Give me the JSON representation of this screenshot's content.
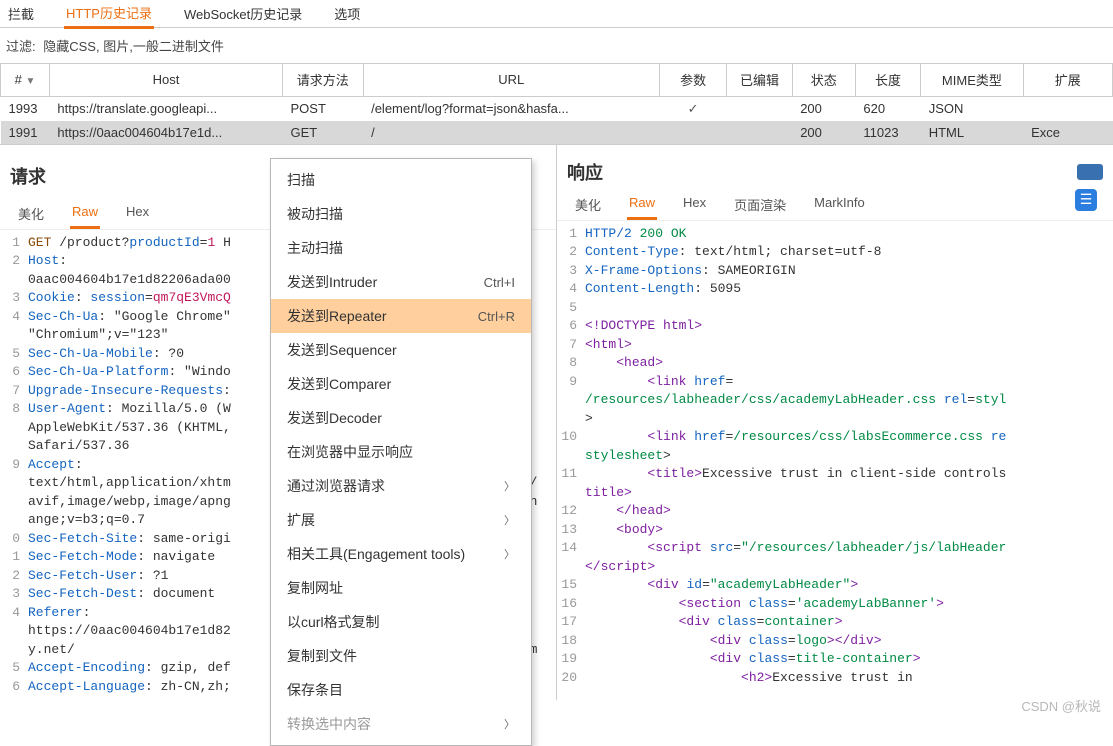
{
  "topTabs": {
    "intercept": "拦截",
    "http": "HTTP历史记录",
    "ws": "WebSocket历史记录",
    "options": "选项"
  },
  "filter": {
    "label": "过滤:",
    "value": "隐藏CSS, 图片,一般二进制文件"
  },
  "table": {
    "headers": {
      "id": "#",
      "host": "Host",
      "method": "请求方法",
      "url": "URL",
      "params": "参数",
      "edited": "已编辑",
      "status": "状态",
      "len": "长度",
      "mime": "MIME类型",
      "ext": "扩展"
    },
    "rows": [
      {
        "id": "1993",
        "host": "https://translate.googleapi...",
        "method": "POST",
        "url": "/element/log?format=json&hasfa...",
        "params": "✓",
        "edited": "",
        "status": "200",
        "len": "620",
        "mime": "JSON",
        "ext": ""
      },
      {
        "id": "1991",
        "host": "https://0aac004604b17e1d...",
        "method": "GET",
        "url": "/",
        "params": "",
        "edited": "",
        "status": "200",
        "len": "11023",
        "mime": "HTML",
        "ext": "Exce"
      }
    ]
  },
  "panes": {
    "request": {
      "title": "请求",
      "tabs": {
        "pretty": "美化",
        "raw": "Raw",
        "hex": "Hex"
      }
    },
    "response": {
      "title": "响应",
      "tabs": {
        "pretty": "美化",
        "raw": "Raw",
        "hex": "Hex",
        "render": "页面渲染",
        "mark": "MarkInfo"
      }
    }
  },
  "requestRaw": {
    "lines": [
      "GET /product?productId=1 H",
      "Host:",
      "0aac004604b17e1d82206ada00",
      "Cookie: session=qm7qE3VmcQ",
      "Sec-Ch-Ua: \"Google Chrome\"",
      "\"Chromium\";v=\"123\"",
      "Sec-Ch-Ua-Mobile: ?0",
      "Sec-Ch-Ua-Platform: \"Windo",
      "Upgrade-Insecure-Requests:",
      "User-Agent: Mozilla/5.0 (W",
      "AppleWebKit/537.36 (KHTML,",
      "Safari/537.36",
      "Accept:",
      "text/html,application/xhtm",
      "avif,image/webp,image/apng",
      "ange;v=b3;q=0.7",
      "Sec-Fetch-Site: same-origi",
      "Sec-Fetch-Mode: navigate",
      "Sec-Fetch-User: ?1",
      "Sec-Fetch-Dest: document",
      "Referer:",
      "https://0aac004604b17e1d82",
      "y.net/",
      "Accept-Encoding: gzip, def",
      "Accept-Language: zh-CN,zh;"
    ],
    "gutter": [
      "1",
      "2",
      "",
      "3",
      "4",
      "",
      "5",
      "6",
      "7",
      "8",
      "",
      "",
      "9",
      "",
      "",
      "",
      "0",
      "1",
      "2",
      "3",
      "4",
      "",
      "",
      "5",
      "6"
    ],
    "trailing": [
      "",
      "",
      "",
      "",
      "",
      "ge/",
      "xch",
      "",
      "",
      "",
      "",
      "",
      "",
      "",
      "dem",
      "",
      ""
    ],
    "trailingFrom": 8
  },
  "responseRaw": {
    "gutter": [
      "1",
      "2",
      "3",
      "4",
      "5",
      "6",
      "7",
      "8",
      "9",
      "",
      "",
      "10",
      "",
      "11",
      "",
      "12",
      "13",
      "14",
      "",
      "15",
      "16",
      "17",
      "18",
      "19",
      "20"
    ]
  },
  "contextMenu": {
    "items": [
      {
        "label": "扫描"
      },
      {
        "label": "被动扫描"
      },
      {
        "label": "主动扫描"
      },
      {
        "label": "发送到Intruder",
        "shortcut": "Ctrl+I"
      },
      {
        "label": "发送到Repeater",
        "shortcut": "Ctrl+R",
        "highlight": true
      },
      {
        "label": "发送到Sequencer"
      },
      {
        "label": "发送到Comparer"
      },
      {
        "label": "发送到Decoder"
      },
      {
        "label": "在浏览器中显示响应"
      },
      {
        "label": "通过浏览器请求",
        "submenu": true
      },
      {
        "label": "扩展",
        "submenu": true
      },
      {
        "label": "相关工具(Engagement tools)",
        "submenu": true
      },
      {
        "label": "复制网址"
      },
      {
        "label": "以curl格式复制"
      },
      {
        "label": "复制到文件"
      },
      {
        "label": "保存条目"
      },
      {
        "label": "转换选中内容",
        "submenu": true,
        "disabled": true
      }
    ]
  },
  "watermark": "CSDN @秋说"
}
